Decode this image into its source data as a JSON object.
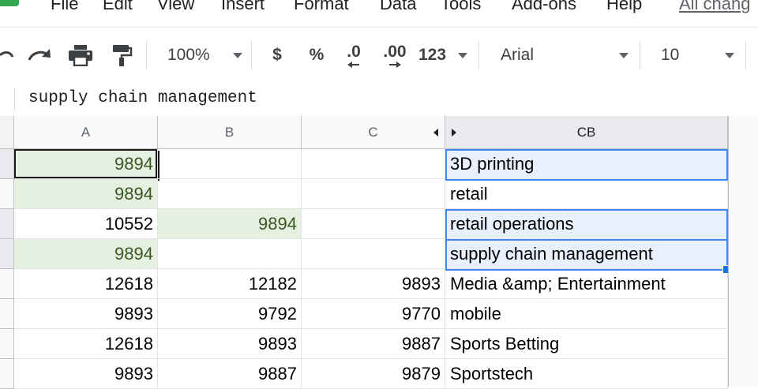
{
  "menu": {
    "items": [
      "File",
      "Edit",
      "View",
      "Insert",
      "Format",
      "Data",
      "Tools",
      "Add-ons",
      "Help"
    ],
    "status": "All chang"
  },
  "toolbar": {
    "zoom": "100%",
    "currency": "$",
    "percent": "%",
    "decrease_decimals": ".0",
    "increase_decimals": ".00",
    "more_formats": "123",
    "font": "Arial",
    "font_size": "10"
  },
  "formula_bar": {
    "value": "supply chain management"
  },
  "sheet": {
    "columns": [
      "A",
      "B",
      "C",
      "CB"
    ],
    "rows": [
      [
        "9894",
        "",
        "",
        "3D printing"
      ],
      [
        "9894",
        "",
        "",
        "retail"
      ],
      [
        "10552",
        "9894",
        "",
        "retail operations"
      ],
      [
        "9894",
        "",
        "",
        "supply chain management"
      ],
      [
        "12618",
        "12182",
        "9893",
        "Media &amp; Entertainment"
      ],
      [
        "9893",
        "9792",
        "9770",
        "mobile"
      ],
      [
        "12618",
        "9893",
        "9887",
        "Sports Betting"
      ],
      [
        "9893",
        "9887",
        "9879",
        "Sportstech"
      ]
    ]
  },
  "colors": {
    "highlight_fill": "#e6f0e0",
    "highlight_text": "#385723",
    "selection_blue": "#4285f4",
    "logo_green": "#34a853"
  }
}
